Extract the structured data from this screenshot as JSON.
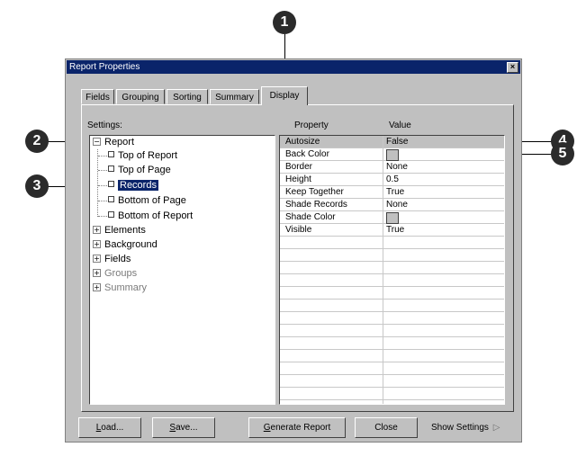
{
  "callouts": [
    "1",
    "2",
    "3",
    "4",
    "5"
  ],
  "window": {
    "title": "Report Properties",
    "close_glyph": "×"
  },
  "tabs": [
    {
      "label": "Fields",
      "active": false
    },
    {
      "label": "Grouping",
      "active": false
    },
    {
      "label": "Sorting",
      "active": false
    },
    {
      "label": "Summary",
      "active": false
    },
    {
      "label": "Display",
      "active": true
    }
  ],
  "settings_label": "Settings:",
  "tree": {
    "root": {
      "expander": "−",
      "label": "Report"
    },
    "children": [
      {
        "label": "Top of Report",
        "selected": false
      },
      {
        "label": "Top of Page",
        "selected": false
      },
      {
        "label": "Records",
        "selected": true
      },
      {
        "label": "Bottom of Page",
        "selected": false
      },
      {
        "label": "Bottom of Report",
        "selected": false
      }
    ],
    "groups": [
      {
        "expander": "+",
        "label": "Elements",
        "enabled": true
      },
      {
        "expander": "+",
        "label": "Background",
        "enabled": true
      },
      {
        "expander": "+",
        "label": "Fields",
        "enabled": true
      },
      {
        "expander": "+",
        "label": "Groups",
        "enabled": false
      },
      {
        "expander": "+",
        "label": "Summary",
        "enabled": false
      }
    ]
  },
  "grid": {
    "header_property": "Property",
    "header_value": "Value",
    "rows": [
      {
        "property": "Autosize",
        "value": "False",
        "swatch": false,
        "highlighted": true
      },
      {
        "property": "Back Color",
        "value": "",
        "swatch": true,
        "highlighted": false
      },
      {
        "property": "Border",
        "value": "None",
        "swatch": false,
        "highlighted": false
      },
      {
        "property": "Height",
        "value": "0.5",
        "swatch": false,
        "highlighted": false
      },
      {
        "property": "Keep Together",
        "value": "True",
        "swatch": false,
        "highlighted": false
      },
      {
        "property": "Shade Records",
        "value": "None",
        "swatch": false,
        "highlighted": false
      },
      {
        "property": "Shade Color",
        "value": "",
        "swatch": true,
        "highlighted": false
      },
      {
        "property": "Visible",
        "value": "True",
        "swatch": false,
        "highlighted": false
      }
    ]
  },
  "buttons": {
    "load": {
      "accel": "L",
      "rest": "oad..."
    },
    "save": {
      "accel": "S",
      "rest": "ave..."
    },
    "generate": {
      "accel": "G",
      "rest": "enerate Report"
    },
    "close": "Close",
    "show_settings": "Show Settings",
    "show_settings_glyph": "▷"
  },
  "colors": {
    "titlebar": "#0a246a",
    "dialog": "#c0c0c0",
    "callout": "#2b2b2b"
  }
}
